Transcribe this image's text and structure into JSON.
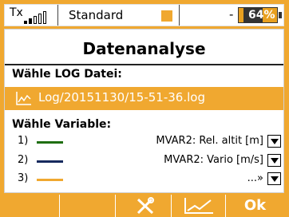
{
  "status": {
    "tx_label": "Tx",
    "model_name": "Standard",
    "separator_text": "-",
    "battery_text": "64%",
    "battery_level": 0.64
  },
  "screen": {
    "title": "Datenanalyse",
    "log_section_label": "Wähle LOG Datei:",
    "log_file": "Log/20151130/15-51-36.log",
    "variable_section_label": "Wähle Variable:",
    "variables": [
      {
        "num": "1)",
        "value": "MVAR2: Rel. altit  [m]",
        "color": "#1f6e12"
      },
      {
        "num": "2)",
        "value": "MVAR2: Vario  [m/s]",
        "color": "#162a5e"
      },
      {
        "num": "3)",
        "value": "...»",
        "color": "#f0a830"
      }
    ]
  },
  "func_bar": {
    "ok_label": "Ok"
  },
  "icons": [
    "signal-bars-icon",
    "chart-icon",
    "wrench-screwdriver-icon",
    "graph-icon"
  ],
  "colors": {
    "accent": "#f0a830",
    "background": "#ffffff"
  }
}
